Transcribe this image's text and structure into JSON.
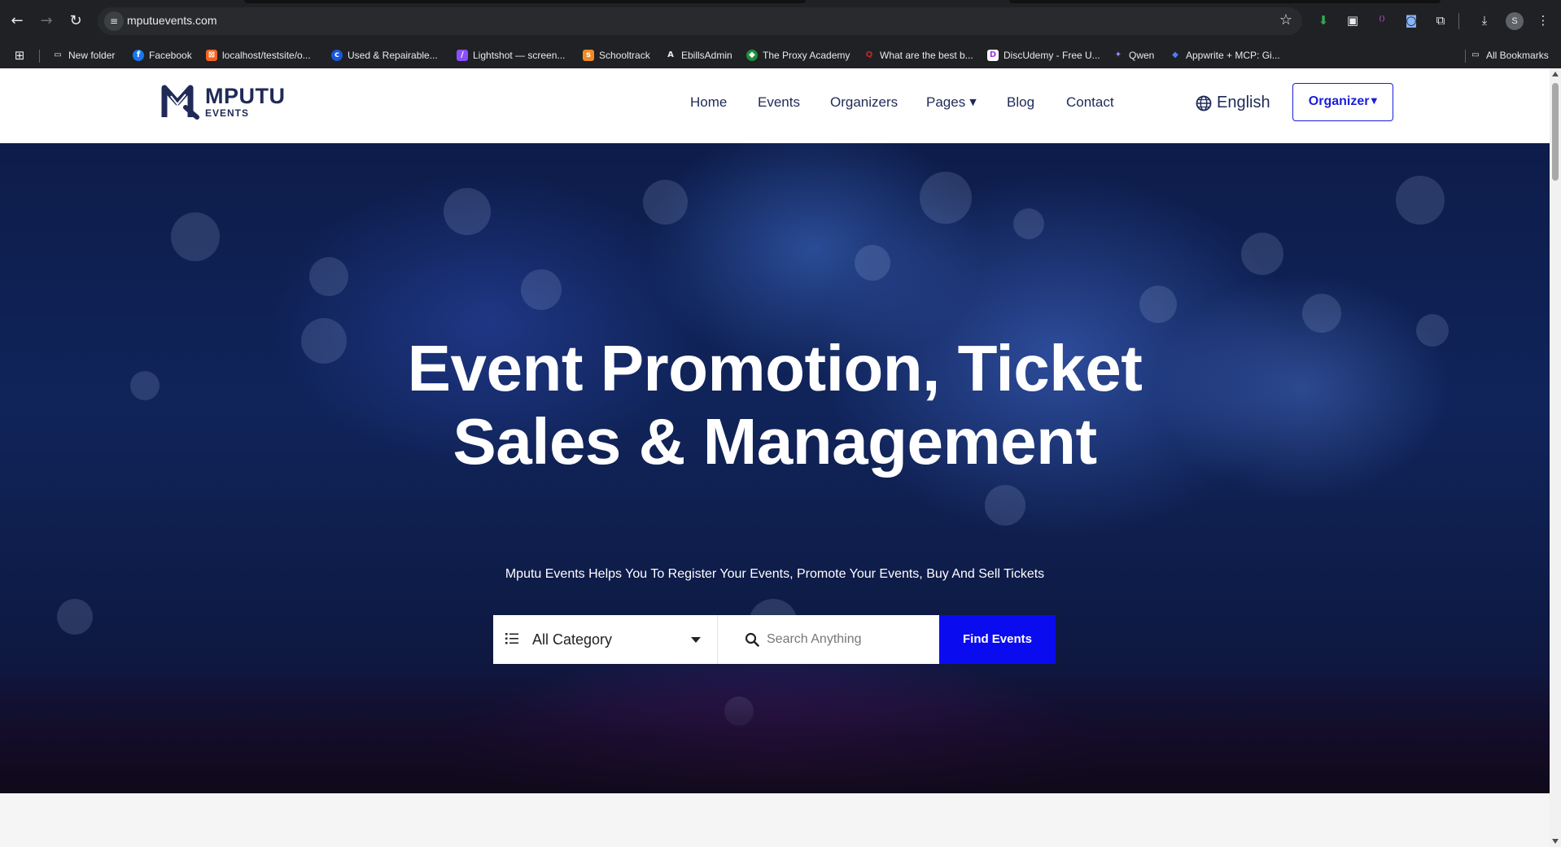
{
  "browser": {
    "url": "mputuevents.com",
    "bookmarks": [
      {
        "label": "New folder",
        "icon": "folder-icon"
      },
      {
        "label": "Facebook",
        "icon": "facebook-icon"
      },
      {
        "label": "localhost/testsite/o...",
        "icon": "localhost-icon"
      },
      {
        "label": "Used & Repairable...",
        "icon": "copart-icon"
      },
      {
        "label": "Lightshot — screen...",
        "icon": "lightshot-icon"
      },
      {
        "label": "Schooltrack",
        "icon": "schooltrack-icon"
      },
      {
        "label": "EbillsAdmin",
        "icon": "ebills-icon"
      },
      {
        "label": "The Proxy Academy",
        "icon": "proxy-academy-icon"
      },
      {
        "label": "What are the best b...",
        "icon": "quora-icon"
      },
      {
        "label": "DiscUdemy - Free U...",
        "icon": "discudemy-icon"
      },
      {
        "label": "Qwen",
        "icon": "qwen-icon"
      },
      {
        "label": "Appwrite + MCP: Gi...",
        "icon": "appwrite-icon"
      }
    ],
    "all_bookmarks_label": "All Bookmarks",
    "profile_initial": "S"
  },
  "header": {
    "logo_line1": "MPUTU",
    "logo_line2": "EVENTS",
    "nav": [
      {
        "label": "Home"
      },
      {
        "label": "Events"
      },
      {
        "label": "Organizers"
      },
      {
        "label": "Pages"
      },
      {
        "label": "Blog"
      },
      {
        "label": "Contact"
      }
    ],
    "language": "English",
    "organizer_button": "Organizer"
  },
  "hero": {
    "title_line1": "Event Promotion, Ticket",
    "title_line2": "Sales & Management",
    "subtitle": "Mputu Events Helps You To Register Your Events, Promote Your Events, Buy And Sell Tickets",
    "category_select": "All Category",
    "search_placeholder": "Search Anything",
    "search_value": "",
    "find_button": "Find Events"
  },
  "colors": {
    "brand_navy": "#1f2a57",
    "accent_blue": "#0b0bef",
    "organizer_border": "#1a1fd6"
  }
}
